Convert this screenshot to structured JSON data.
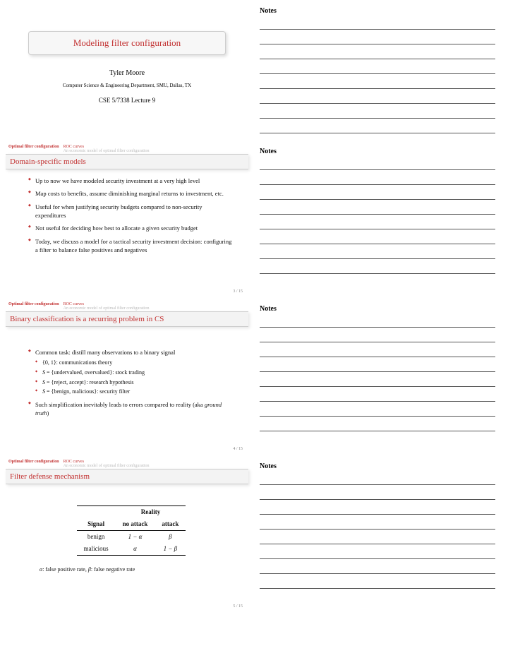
{
  "notes_label": "Notes",
  "title_slide": {
    "title": "Modeling filter configuration",
    "author": "Tyler Moore",
    "affiliation": "Computer Science & Engineering Department, SMU, Dallas, TX",
    "course": "CSE 5/7338 Lecture 9"
  },
  "nav": {
    "section": "Optimal filter configuration",
    "sub1": "ROC curves",
    "sub2": "An economic model of optimal filter configuration"
  },
  "slide2": {
    "title": "Domain-specific models",
    "items": [
      "Up to now we have modeled security investment at a very high level",
      "Map costs to benefits, assume diminishing marginal returns to investment, etc.",
      "Useful for when justifying security budgets compared to non-security expenditures",
      "Not useful for deciding how best to allocate a given security budget",
      "Today, we discuss a model for a tactical security investment decision: configuring a filter to balance false positives and negatives"
    ],
    "page": "3 / 15"
  },
  "slide3": {
    "title": "Binary classification is a recurring problem in CS",
    "item1": "Common task: distill many observations to a binary signal",
    "sub": [
      "{0, 1}: communications theory",
      "S = {undervalued, overvalued}: stock trading",
      "S = {reject, accept}: research hypothesis",
      "S = {benign, malicious}: security filter"
    ],
    "item2a": "Such simplification inevitably leads to errors compared to reality (aka ",
    "item2b": "ground truth",
    "item2c": ")",
    "page": "4 / 15"
  },
  "slide4": {
    "title": "Filter defense mechanism",
    "table": {
      "reality": "Reality",
      "signal": "Signal",
      "noattack": "no attack",
      "attack": "attack",
      "benign": "benign",
      "malicious": "malicious",
      "c11": "1 − α",
      "c12": "β",
      "c21": "α",
      "c22": "1 − β"
    },
    "caption_a": "α",
    "caption_b": ": false positive rate, ",
    "caption_c": "β",
    "caption_d": ": false negative rate",
    "page": "5 / 15"
  }
}
